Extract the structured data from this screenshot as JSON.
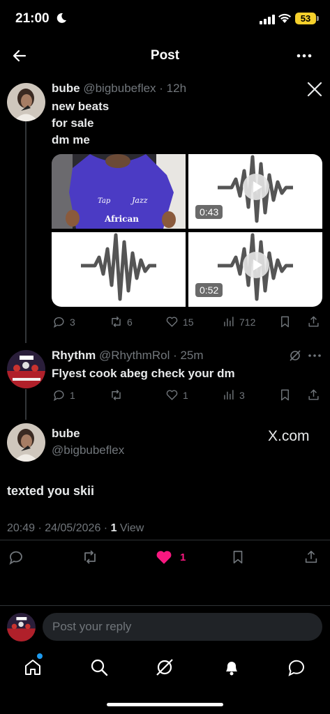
{
  "status_bar": {
    "time": "21:00",
    "battery": "53"
  },
  "header": {
    "title": "Post"
  },
  "original_post": {
    "display_name": "bube",
    "handle": "@bigbubeflex",
    "time": "12h",
    "text_lines": [
      "new beats",
      "for sale",
      "dm me"
    ],
    "media": {
      "shirt_text": [
        "Tap",
        "Jazz",
        "African"
      ],
      "durations": [
        "0:43",
        "0:52"
      ]
    },
    "stats": {
      "replies": "3",
      "reposts": "6",
      "likes": "15",
      "views": "712"
    }
  },
  "reply_post": {
    "display_name": "Rhythm",
    "handle": "@RhythmRol",
    "time": "25m",
    "text": "Flyest cook abeg check your dm",
    "stats": {
      "replies": "1",
      "reposts": "",
      "likes": "1",
      "views": "3"
    }
  },
  "focus_post": {
    "display_name": "bube",
    "handle": "@bigbubeflex",
    "source": "X.com",
    "text": "texted you skii",
    "time": "20:49",
    "date": "24/05/2026",
    "view_count": "1",
    "view_label": "View",
    "likes": "1"
  },
  "composer": {
    "placeholder": "Post your reply"
  },
  "colors": {
    "accent": "#1d9bf0",
    "like": "#f91880",
    "background": "#000000"
  }
}
